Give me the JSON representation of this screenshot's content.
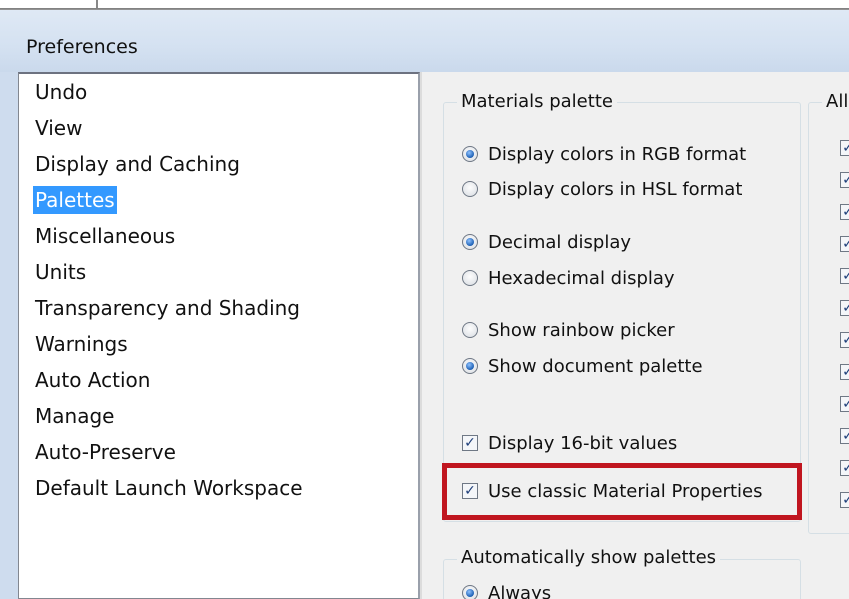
{
  "window": {
    "title": "Preferences"
  },
  "categories": [
    {
      "label": "Undo"
    },
    {
      "label": "View"
    },
    {
      "label": "Display and Caching"
    },
    {
      "label": "Palettes",
      "selected": true
    },
    {
      "label": "Miscellaneous"
    },
    {
      "label": "Units"
    },
    {
      "label": "Transparency and Shading"
    },
    {
      "label": "Warnings"
    },
    {
      "label": "Auto Action"
    },
    {
      "label": "Manage"
    },
    {
      "label": "Auto-Preserve"
    },
    {
      "label": "Default Launch Workspace"
    }
  ],
  "materials_palette": {
    "caption": "Materials palette",
    "rgb_label": "Display colors in RGB format",
    "rgb_selected": true,
    "hsl_label": "Display colors in HSL format",
    "hsl_selected": false,
    "decimal_label": "Decimal display",
    "decimal_selected": true,
    "hex_label": "Hexadecimal display",
    "hex_selected": false,
    "rainbow_label": "Show rainbow picker",
    "rainbow_selected": false,
    "document_palette_label": "Show document palette",
    "document_palette_selected": true,
    "sixteen_bit_label": "Display 16-bit values",
    "sixteen_bit_checked": true,
    "classic_props_label": "Use classic Material Properties",
    "classic_props_checked": true
  },
  "right_group": {
    "caption": "Allo",
    "checked_count": 12
  },
  "auto_show": {
    "caption": "Automatically show palettes",
    "always_label": "Always",
    "always_selected": true
  },
  "check_mark": "✓",
  "colors": {
    "selection": "#3399ff",
    "highlight_border": "#c0151f"
  }
}
